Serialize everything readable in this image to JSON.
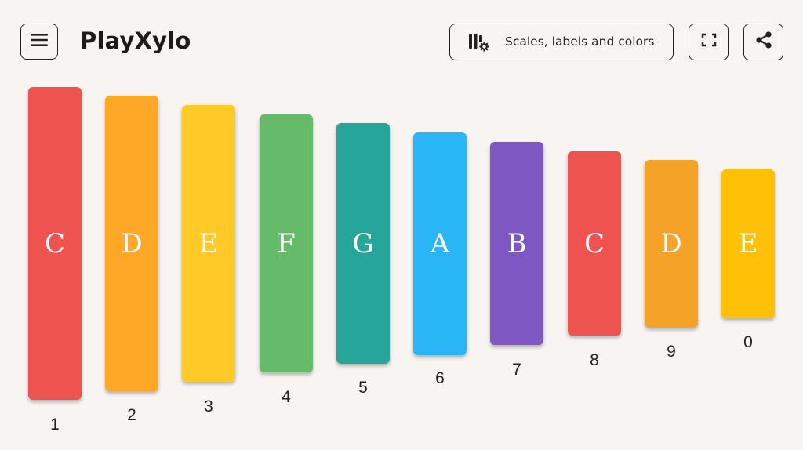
{
  "header": {
    "title": "PlayXylo",
    "menu_icon": "hamburger-menu-icon",
    "settings_label": "Scales, labels and colors",
    "settings_icon": "bars-settings-icon",
    "fullscreen_icon": "fullscreen-icon",
    "share_icon": "share-icon"
  },
  "xylophone": {
    "bars": [
      {
        "note": "C",
        "key": "1",
        "color": "#ef5350"
      },
      {
        "note": "D",
        "key": "2",
        "color": "#ffa726"
      },
      {
        "note": "E",
        "key": "3",
        "color": "#ffca28"
      },
      {
        "note": "F",
        "key": "4",
        "color": "#66bb6a"
      },
      {
        "note": "G",
        "key": "5",
        "color": "#26a69a"
      },
      {
        "note": "A",
        "key": "6",
        "color": "#29b6f6"
      },
      {
        "note": "B",
        "key": "7",
        "color": "#7e57c2"
      },
      {
        "note": "C",
        "key": "8",
        "color": "#ef5350"
      },
      {
        "note": "D",
        "key": "9",
        "color": "#f5a328"
      },
      {
        "note": "E",
        "key": "0",
        "color": "#ffc107"
      }
    ]
  }
}
